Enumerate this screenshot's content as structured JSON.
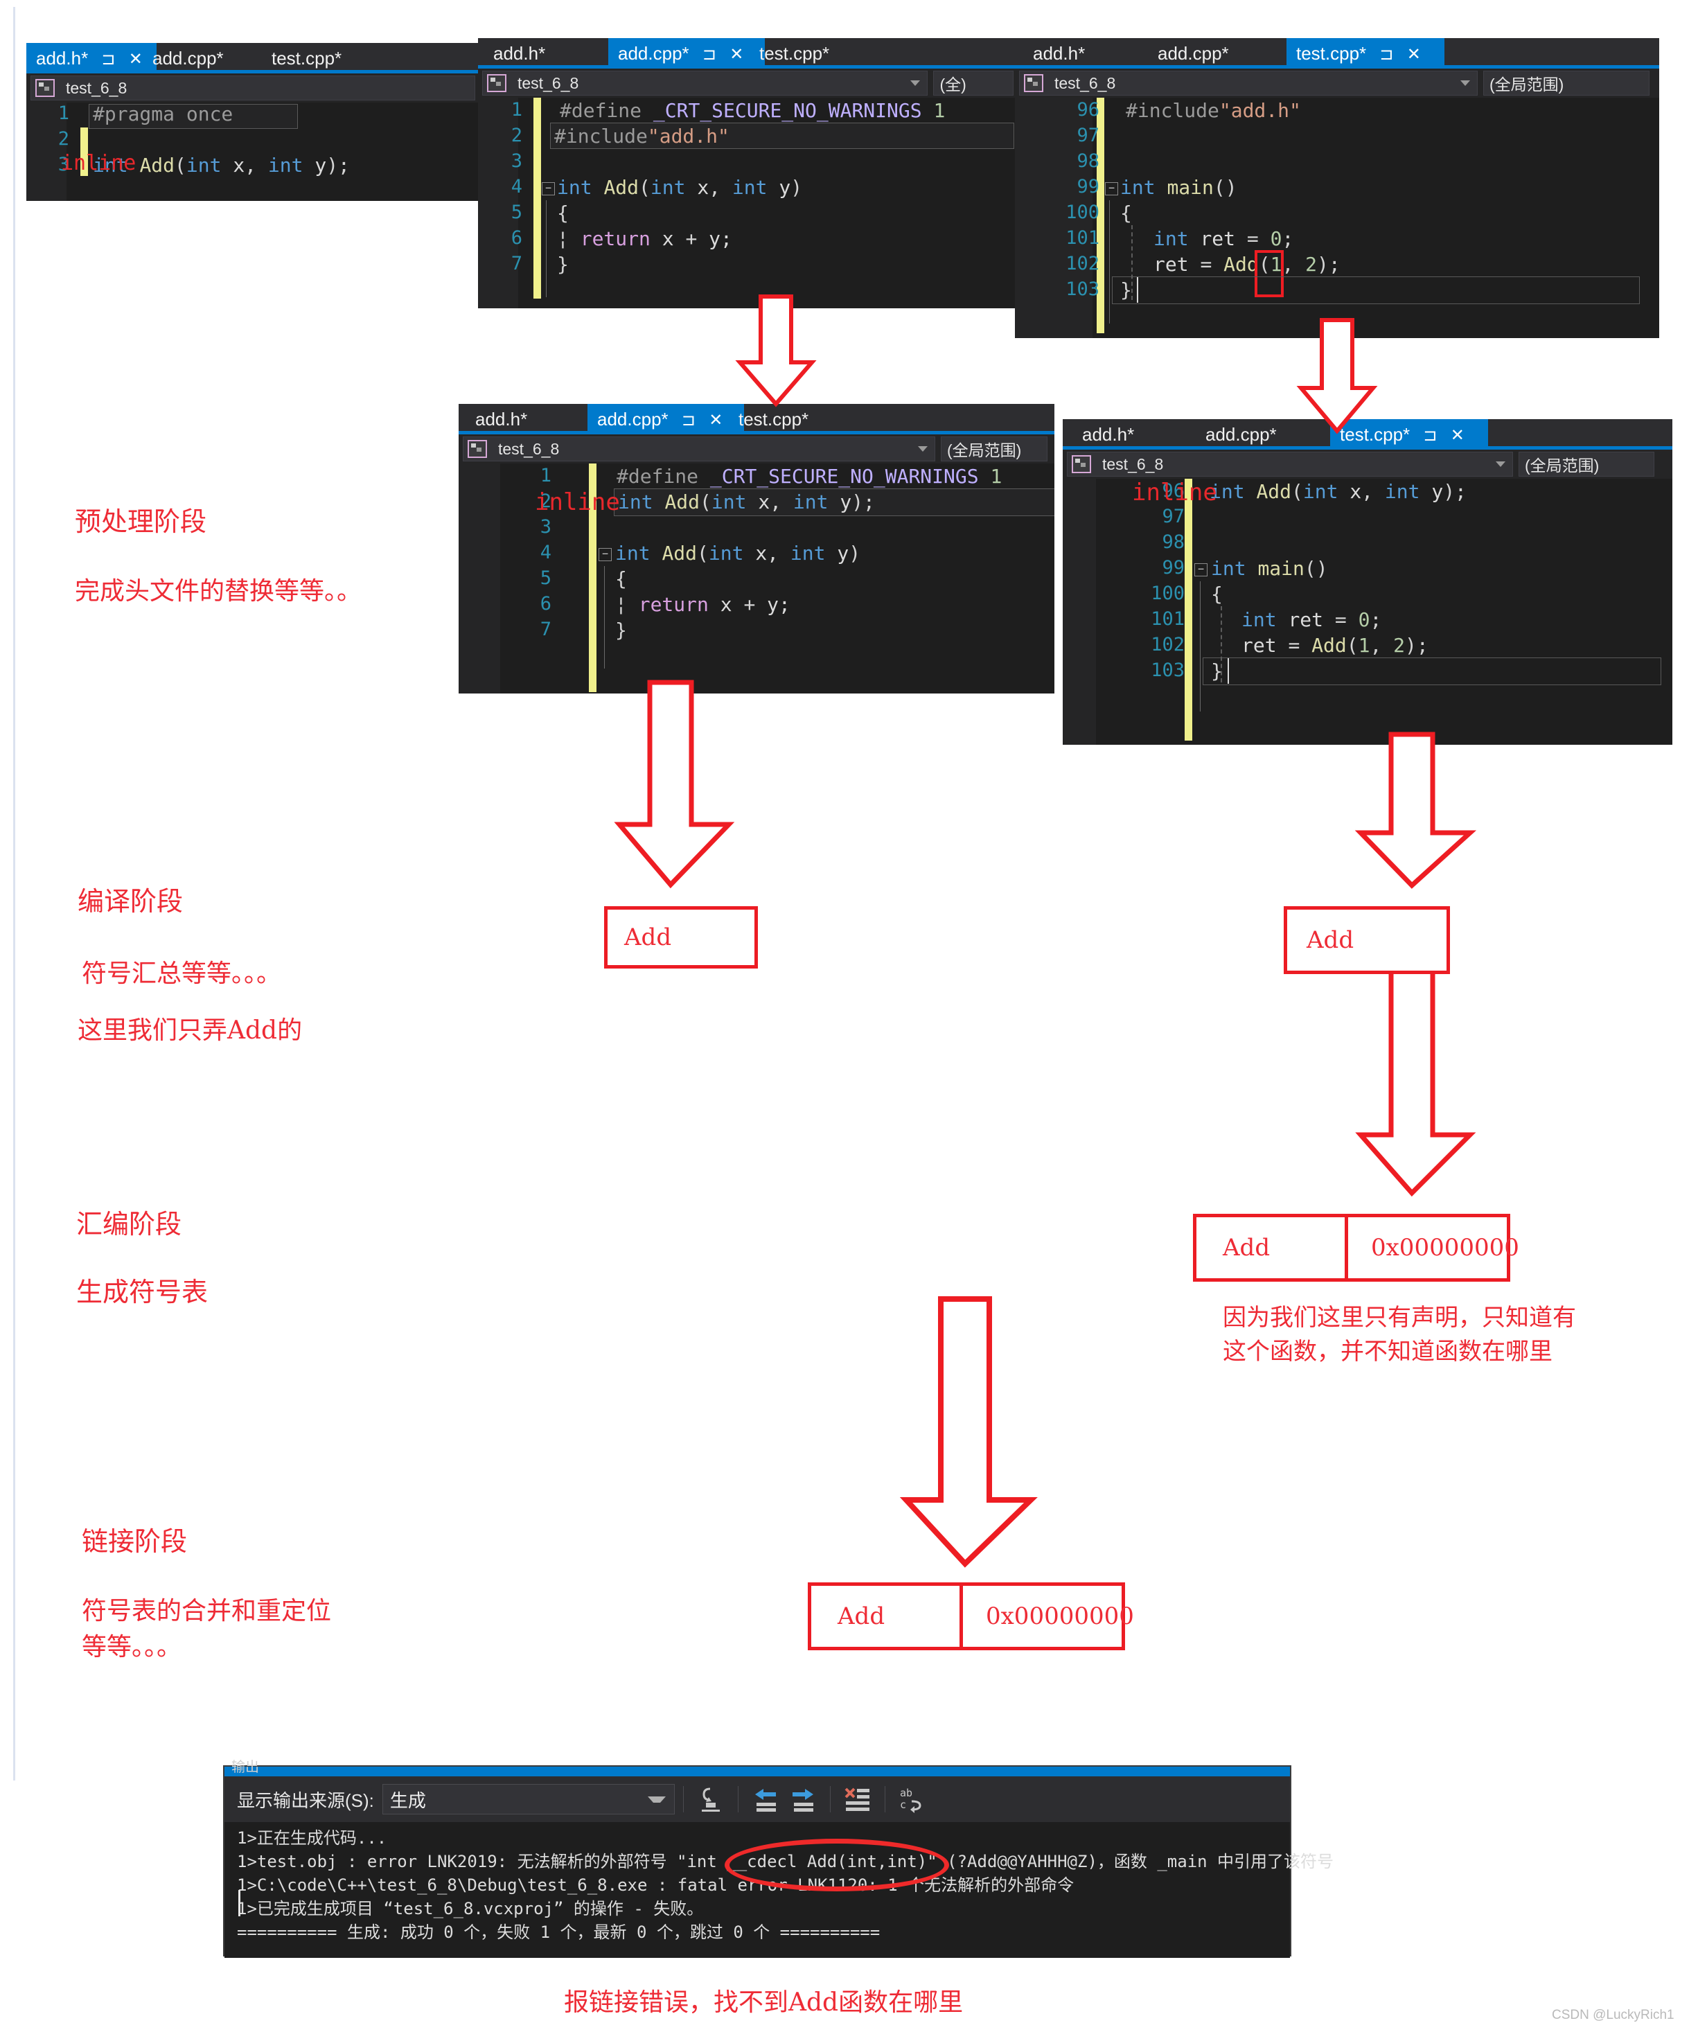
{
  "editors": [
    {
      "id": "addh-top",
      "tabs": [
        {
          "label": "add.h*",
          "active": true,
          "pin": "⊐",
          "close": "✕"
        },
        {
          "label": "add.cpp*",
          "active": false
        },
        {
          "label": "test.cpp*",
          "active": false
        }
      ],
      "nav": {
        "project": "test_6_8",
        "scope": ""
      },
      "lines": [
        {
          "no": "1",
          "text": "#pragma once"
        },
        {
          "no": "2",
          "text": ""
        },
        {
          "no": "3",
          "text": "int Add(int x, int y);"
        }
      ],
      "overlay_word": "inline"
    },
    {
      "id": "addcpp-top",
      "tabs": [
        {
          "label": "add.h*",
          "active": false
        },
        {
          "label": "add.cpp*",
          "active": true,
          "pin": "⊐",
          "close": "✕"
        },
        {
          "label": "test.cpp*",
          "active": false
        }
      ],
      "nav": {
        "project": "test_6_8",
        "scope": "(全)"
      },
      "lines": [
        {
          "no": "1",
          "text": "#define _CRT_SECURE_NO_WARNINGS 1"
        },
        {
          "no": "2",
          "text": "#include\"add.h\""
        },
        {
          "no": "3",
          "text": ""
        },
        {
          "no": "4",
          "text": "int Add(int x, int y)"
        },
        {
          "no": "5",
          "text": "{"
        },
        {
          "no": "6",
          "text": "    return x + y;"
        },
        {
          "no": "7",
          "text": "}"
        }
      ]
    },
    {
      "id": "testcpp-top",
      "tabs": [
        {
          "label": "add.h*",
          "active": false
        },
        {
          "label": "add.cpp*",
          "active": false
        },
        {
          "label": "test.cpp*",
          "active": true,
          "pin": "⊐",
          "close": "✕"
        }
      ],
      "nav": {
        "project": "test_6_8",
        "scope": "(全局范围)"
      },
      "lines": [
        {
          "no": "96",
          "text": "#include\"add.h\""
        },
        {
          "no": "97",
          "text": ""
        },
        {
          "no": "98",
          "text": ""
        },
        {
          "no": "99",
          "text": "int main()"
        },
        {
          "no": "100",
          "text": "{"
        },
        {
          "no": "101",
          "text": "    int ret = 0;"
        },
        {
          "no": "102",
          "text": "    ret = Add(1, 2);"
        },
        {
          "no": "103",
          "text": "}"
        }
      ]
    },
    {
      "id": "addcpp-pre",
      "tabs": [
        {
          "label": "add.h*",
          "active": false
        },
        {
          "label": "add.cpp*",
          "active": true,
          "pin": "⊐",
          "close": "✕"
        },
        {
          "label": "test.cpp*",
          "active": false
        }
      ],
      "nav": {
        "project": "test_6_8",
        "scope": "(全局范围)"
      },
      "lines": [
        {
          "no": "1",
          "text": "#define _CRT_SECURE_NO_WARNINGS 1"
        },
        {
          "no": "2",
          "text": "int Add(int x, int y);"
        },
        {
          "no": "3",
          "text": ""
        },
        {
          "no": "4",
          "text": "int Add(int x, int y)"
        },
        {
          "no": "5",
          "text": "{"
        },
        {
          "no": "6",
          "text": "    return x + y;"
        },
        {
          "no": "7",
          "text": "}"
        }
      ],
      "overlay_word": "inline"
    },
    {
      "id": "testcpp-pre",
      "tabs": [
        {
          "label": "add.h*",
          "active": false
        },
        {
          "label": "add.cpp*",
          "active": false
        },
        {
          "label": "test.cpp*",
          "active": true,
          "pin": "⊐",
          "close": "✕"
        }
      ],
      "nav": {
        "project": "test_6_8",
        "scope": "(全局范围)"
      },
      "lines": [
        {
          "no": "96",
          "text": "int Add(int x, int y);"
        },
        {
          "no": "97",
          "text": ""
        },
        {
          "no": "98",
          "text": ""
        },
        {
          "no": "99",
          "text": "int main()"
        },
        {
          "no": "100",
          "text": "{"
        },
        {
          "no": "101",
          "text": "    int ret = 0;"
        },
        {
          "no": "102",
          "text": "    ret = Add(1, 2);"
        },
        {
          "no": "103",
          "text": "}"
        }
      ],
      "overlay_word": "inline"
    }
  ],
  "stages": {
    "preprocess": {
      "title": "预处理阶段",
      "desc": "完成头文件的替换等等。。"
    },
    "compile": {
      "title": "编译阶段",
      "desc1": "符号汇总等等。。。",
      "desc2": "这里我们只弄Add的"
    },
    "assemble": {
      "title": "汇编阶段",
      "desc": "生成符号表"
    },
    "link": {
      "title": "链接阶段",
      "desc": "符号表的合并和重定位\n等等。。。"
    }
  },
  "symbols": {
    "compile_left": {
      "name": "Add"
    },
    "compile_right": {
      "name": "Add"
    },
    "assemble_right": {
      "name": "Add",
      "address": "0x00000000"
    },
    "assemble_note": "因为我们这里只有声明，只知道有\n这个函数，并不知道函数在哪里",
    "link_table": {
      "name": "Add",
      "address": "0x00000000"
    }
  },
  "output": {
    "window_title": "输出",
    "source_label": "显示输出来源(S):",
    "source_value": "生成",
    "toolbar_icons": [
      "jump-to-source-icon",
      "navigate-back-icon",
      "navigate-forward-icon",
      "clear-all-icon",
      "toggle-word-wrap-icon"
    ],
    "lines": [
      "1>正在生成代码...",
      "1>test.obj : error LNK2019: 无法解析的外部符号 \"int __cdecl Add(int,int)\" (?Add@@YAHHH@Z)，函数 _main 中引用了该符号",
      "1>C:\\code\\C++\\test_6_8\\Debug\\test_6_8.exe : fatal error LNK1120: 1 个无法解析的外部命令",
      "1>已完成生成项目 “test_6_8.vcxproj” 的操作 - 失败。",
      "========== 生成: 成功 0 个，失败 1 个，最新 0 个，跳过 0 个 =========="
    ],
    "highlight": "LNK1120: 1 个无法解析的外部命令"
  },
  "caption": "报链接错误，找不到Add函数在哪里",
  "watermark": "CSDN @LuckyRich1",
  "colors": {
    "accent": "#007acc",
    "annotation_red": "#ee2b35",
    "box_red": "#ec1c24",
    "editor_bg": "#1e1e1e",
    "gutter_bg": "#252526",
    "changebar_yellow": "#f0f08c"
  }
}
